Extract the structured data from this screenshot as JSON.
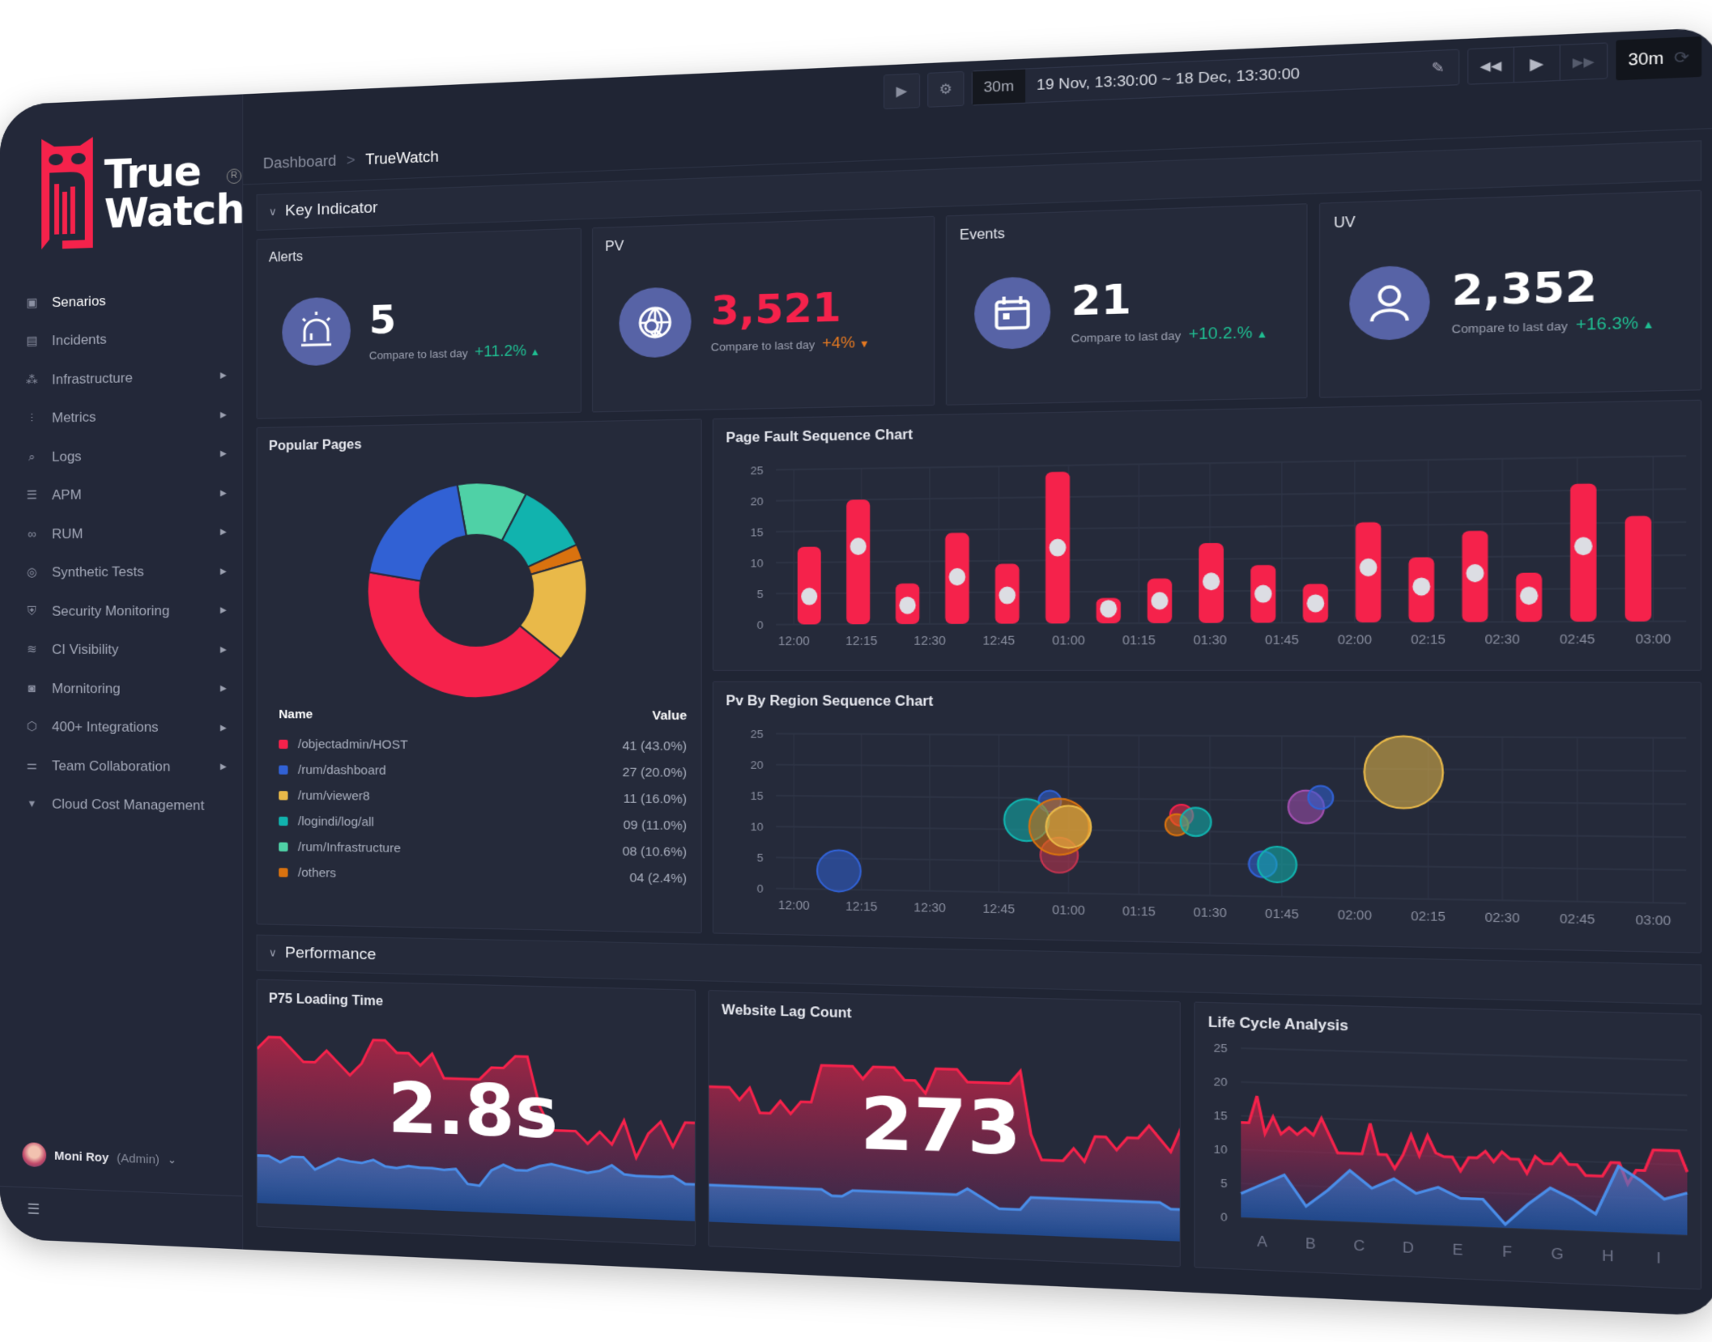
{
  "brand": {
    "line1": "True",
    "line2": "Watch",
    "reg": "R",
    "accent": "#f5224b"
  },
  "sidebar": {
    "items": [
      {
        "label": "Senarios",
        "icon": "monitor-icon",
        "glyph": "▣",
        "active": true,
        "arrow": false
      },
      {
        "label": "Incidents",
        "icon": "incident-icon",
        "glyph": "▤",
        "arrow": false
      },
      {
        "label": "Infrastructure",
        "icon": "infrastructure-icon",
        "glyph": "⁂",
        "arrow": true
      },
      {
        "label": "Metrics",
        "icon": "metrics-icon",
        "glyph": "⫶",
        "arrow": true
      },
      {
        "label": "Logs",
        "icon": "logs-icon",
        "glyph": "⌕",
        "arrow": true
      },
      {
        "label": "APM",
        "icon": "apm-icon",
        "glyph": "☰",
        "arrow": true
      },
      {
        "label": "RUM",
        "icon": "rum-icon",
        "glyph": "∞",
        "arrow": true
      },
      {
        "label": "Synthetic Tests",
        "icon": "synthetic-tests-icon",
        "glyph": "◎",
        "arrow": true
      },
      {
        "label": "Security Monitoring",
        "icon": "shield-icon",
        "glyph": "⛨",
        "arrow": true
      },
      {
        "label": "CI Visibility",
        "icon": "ci-icon",
        "glyph": "≋",
        "arrow": true
      },
      {
        "label": "Mornitoring",
        "icon": "camera-icon",
        "glyph": "◙",
        "arrow": true
      },
      {
        "label": "400+ Integrations",
        "icon": "integrations-icon",
        "glyph": "⬡",
        "arrow": true
      },
      {
        "label": "Team Collaboration",
        "icon": "sliders-icon",
        "glyph": "⚌",
        "arrow": true
      },
      {
        "label": "Cloud Cost Management",
        "icon": "cloud-cost-icon",
        "glyph": "▾",
        "arrow": false
      }
    ],
    "user": {
      "name": "Moni Roy",
      "role": "(Admin)"
    }
  },
  "topbar": {
    "quick_range": "30m",
    "range": "19 Nov, 13:30:00 ~ 18 Dec, 13:30:00",
    "refresh": "30m"
  },
  "breadcrumb": {
    "parent": "Dashboard",
    "sep": ">",
    "current": "TrueWatch"
  },
  "key_indicator": {
    "title": "Key Indicator",
    "cards": [
      {
        "title": "Alerts",
        "value": "5",
        "compare": "Compare to last day",
        "change": "+11.2%",
        "dir": "up",
        "icon": "alarm-icon"
      },
      {
        "title": "PV",
        "value": "3,521",
        "compare": "Compare to last day",
        "change": "+4%",
        "dir": "down",
        "icon": "globe-search-icon"
      },
      {
        "title": "Events",
        "value": "21",
        "compare": "Compare to last day",
        "change": "+10.2.%",
        "dir": "up",
        "icon": "calendar-icon"
      },
      {
        "title": "UV",
        "value": "2,352",
        "compare": "Compare to last day",
        "change": "+16.3%",
        "dir": "up",
        "icon": "user-icon"
      }
    ]
  },
  "performance": {
    "title": "Performance"
  },
  "chart_data": [
    {
      "id": "popular",
      "type": "pie",
      "title": "Popular Pages",
      "legend_headers": [
        "Name",
        "Value"
      ],
      "slices": [
        {
          "name": "/objectadmin/HOST",
          "value": 41,
          "label": "41 (43.0%)",
          "pct": 43.0,
          "color": "#f5224b"
        },
        {
          "name": "/rum/dashboard",
          "value": 27,
          "label": "27 (20.0%)",
          "pct": 20.0,
          "color": "#3161d4"
        },
        {
          "name": "/rum/viewer8",
          "value": 11,
          "label": "11 (16.0%)",
          "pct": 16.0,
          "color": "#e9b949"
        },
        {
          "name": "/logindi/log/all",
          "value": 9,
          "label": "09 (11.0%)",
          "pct": 11.0,
          "color": "#11b3ae"
        },
        {
          "name": "/rum/Infrastructure",
          "value": 8,
          "label": "08 (10.6%)",
          "pct": 10.6,
          "color": "#4fd1a6"
        },
        {
          "name": "/others",
          "value": 4,
          "label": "04 (2.4%)",
          "pct": 2.4,
          "color": "#d9720f"
        }
      ]
    },
    {
      "id": "pagefault",
      "type": "bar",
      "title": "Page Fault Sequence Chart",
      "ylim": [
        0,
        25
      ],
      "yticks": [
        0,
        5,
        10,
        15,
        20,
        25
      ],
      "xticks": [
        "12:00",
        "12:15",
        "12:30",
        "12:45",
        "01:00",
        "01:15",
        "01:30",
        "01:45",
        "02:00",
        "02:15",
        "02:30",
        "02:45",
        "03:00"
      ],
      "values": [
        12.5,
        20,
        6.5,
        14.5,
        9.5,
        24,
        4,
        7,
        12.5,
        9,
        6,
        15.5,
        10,
        14,
        7.5,
        21,
        16
      ],
      "markers": [
        4.5,
        12.5,
        3,
        7.5,
        4.5,
        12,
        2.3,
        3.5,
        6.5,
        4.5,
        3,
        8.5,
        5.5,
        7.5,
        4,
        11.5,
        null
      ],
      "bar_color": "#f5224b",
      "marker_color": "#dcdde3"
    },
    {
      "id": "pvregion",
      "type": "scatter",
      "title": "Pv By Region Sequence Chart",
      "ylim": [
        0,
        25
      ],
      "yticks": [
        0,
        5,
        10,
        15,
        20,
        25
      ],
      "xticks": [
        "12:00",
        "12:15",
        "12:30",
        "12:45",
        "01:00",
        "01:15",
        "01:30",
        "01:45",
        "02:00",
        "02:15",
        "02:30",
        "02:45",
        "03:00"
      ],
      "points": [
        {
          "x": "12:10",
          "y": 3,
          "size": 3,
          "color": "#3161d4"
        },
        {
          "x": "12:56",
          "y": 14.5,
          "size": 1.5,
          "color": "#3161d4"
        },
        {
          "x": "12:51",
          "y": 11.5,
          "size": 3,
          "color": "#11b3ae"
        },
        {
          "x": "12:58",
          "y": 6,
          "size": 2.5,
          "color": "#c2334f"
        },
        {
          "x": "12:58",
          "y": 10.5,
          "size": 4,
          "color": "#d9720f"
        },
        {
          "x": "01:00",
          "y": 10.5,
          "size": 3,
          "color": "#e9b949"
        },
        {
          "x": "01:24",
          "y": 12.5,
          "size": 1.5,
          "color": "#f5224b"
        },
        {
          "x": "01:23",
          "y": 11,
          "size": 1.5,
          "color": "#d9720f"
        },
        {
          "x": "01:27",
          "y": 11.5,
          "size": 2,
          "color": "#11b3ae"
        },
        {
          "x": "01:41",
          "y": 5,
          "size": 1.8,
          "color": "#3161d4"
        },
        {
          "x": "01:44",
          "y": 5,
          "size": 2.5,
          "color": "#11b3ae"
        },
        {
          "x": "01:50",
          "y": 14,
          "size": 2.3,
          "color": "#a24fb0"
        },
        {
          "x": "01:53",
          "y": 15.5,
          "size": 1.6,
          "color": "#3161d4"
        },
        {
          "x": "02:10",
          "y": 19.5,
          "size": 5,
          "color": "#e9b949"
        }
      ]
    },
    {
      "id": "p75",
      "type": "area",
      "title": "P75 Loading Time",
      "big_value": "2.8s",
      "series": [
        {
          "color": "#f5224b",
          "values": [
            13,
            14,
            14,
            13,
            12,
            12,
            13,
            12,
            11,
            12,
            14,
            14,
            13,
            13,
            12,
            13,
            11,
            11,
            11,
            11,
            12,
            12,
            13,
            13,
            9,
            7,
            7,
            7,
            6,
            7,
            6,
            8,
            5,
            7,
            8,
            6,
            8,
            8
          ]
        },
        {
          "color": "#4a8de8",
          "values": [
            4,
            4,
            3.5,
            4,
            4,
            3,
            3.5,
            4,
            3.8,
            3.7,
            4,
            3.5,
            3.4,
            3.6,
            3.5,
            3.5,
            3.4,
            3.5,
            2.3,
            2.2,
            3.5,
            4,
            3.6,
            3.6,
            4,
            4.2,
            4,
            3.8,
            3.6,
            3.8,
            4.3,
            3.6,
            3.5,
            3.5,
            3.5,
            3.6,
            3,
            3
          ]
        }
      ]
    },
    {
      "id": "lag",
      "type": "area",
      "title": "Website Lag Count",
      "big_value": "273",
      "series": [
        {
          "color": "#f5224b",
          "values": [
            11,
            11,
            11,
            10,
            11,
            9,
            9,
            10,
            9,
            10,
            10,
            13,
            13,
            13,
            13,
            12,
            13,
            13,
            13,
            12,
            12,
            11,
            13,
            13,
            13,
            12,
            12,
            12,
            12,
            12,
            13,
            8,
            6,
            6,
            6,
            7,
            6,
            8,
            8,
            7,
            8,
            8,
            9,
            8,
            7,
            9
          ]
        },
        {
          "color": "#4a8de8",
          "values": [
            3,
            3,
            3,
            3,
            3,
            3,
            3,
            3,
            3,
            3,
            3,
            3,
            2.5,
            2.5,
            3,
            3,
            3,
            3,
            3,
            3,
            3,
            3,
            3,
            3,
            3,
            3.5,
            3,
            2.5,
            2,
            2,
            2,
            3,
            3,
            3,
            3,
            3,
            3,
            3,
            3,
            3,
            3,
            3,
            3,
            3,
            2.5,
            2.5
          ]
        }
      ]
    },
    {
      "id": "lifecycle",
      "type": "area",
      "title": "Life Cycle Analysis",
      "ylim": [
        0,
        25
      ],
      "yticks": [
        0,
        5,
        10,
        15,
        20,
        25
      ],
      "categories": [
        "A",
        "B",
        "C",
        "D",
        "E",
        "F",
        "G",
        "H",
        "I"
      ],
      "series": [
        {
          "color": "#f5224b",
          "values": [
            14,
            14,
            18,
            12.5,
            15,
            12.5,
            13.5,
            12.5,
            13.5,
            12.5,
            15,
            12.5,
            10,
            10,
            10,
            10,
            14.5,
            10,
            10,
            8,
            10,
            13,
            10,
            13,
            10.5,
            10,
            10,
            8,
            10,
            10,
            11,
            9.5,
            11,
            10,
            10,
            8,
            10.5,
            9.5,
            9.5,
            11,
            9.5,
            9.5,
            8,
            8,
            8,
            10,
            10,
            7,
            9,
            9,
            12,
            12,
            12,
            12,
            9
          ]
        },
        {
          "color": "#4a8de8",
          "values": [
            3.5,
            5,
            6.5,
            2,
            4.5,
            7.5,
            5,
            6.5,
            4.5,
            5.5,
            4,
            4,
            0.5,
            3.5,
            6,
            4.5,
            2.5,
            9.5,
            7.5,
            5,
            6
          ]
        }
      ]
    }
  ]
}
